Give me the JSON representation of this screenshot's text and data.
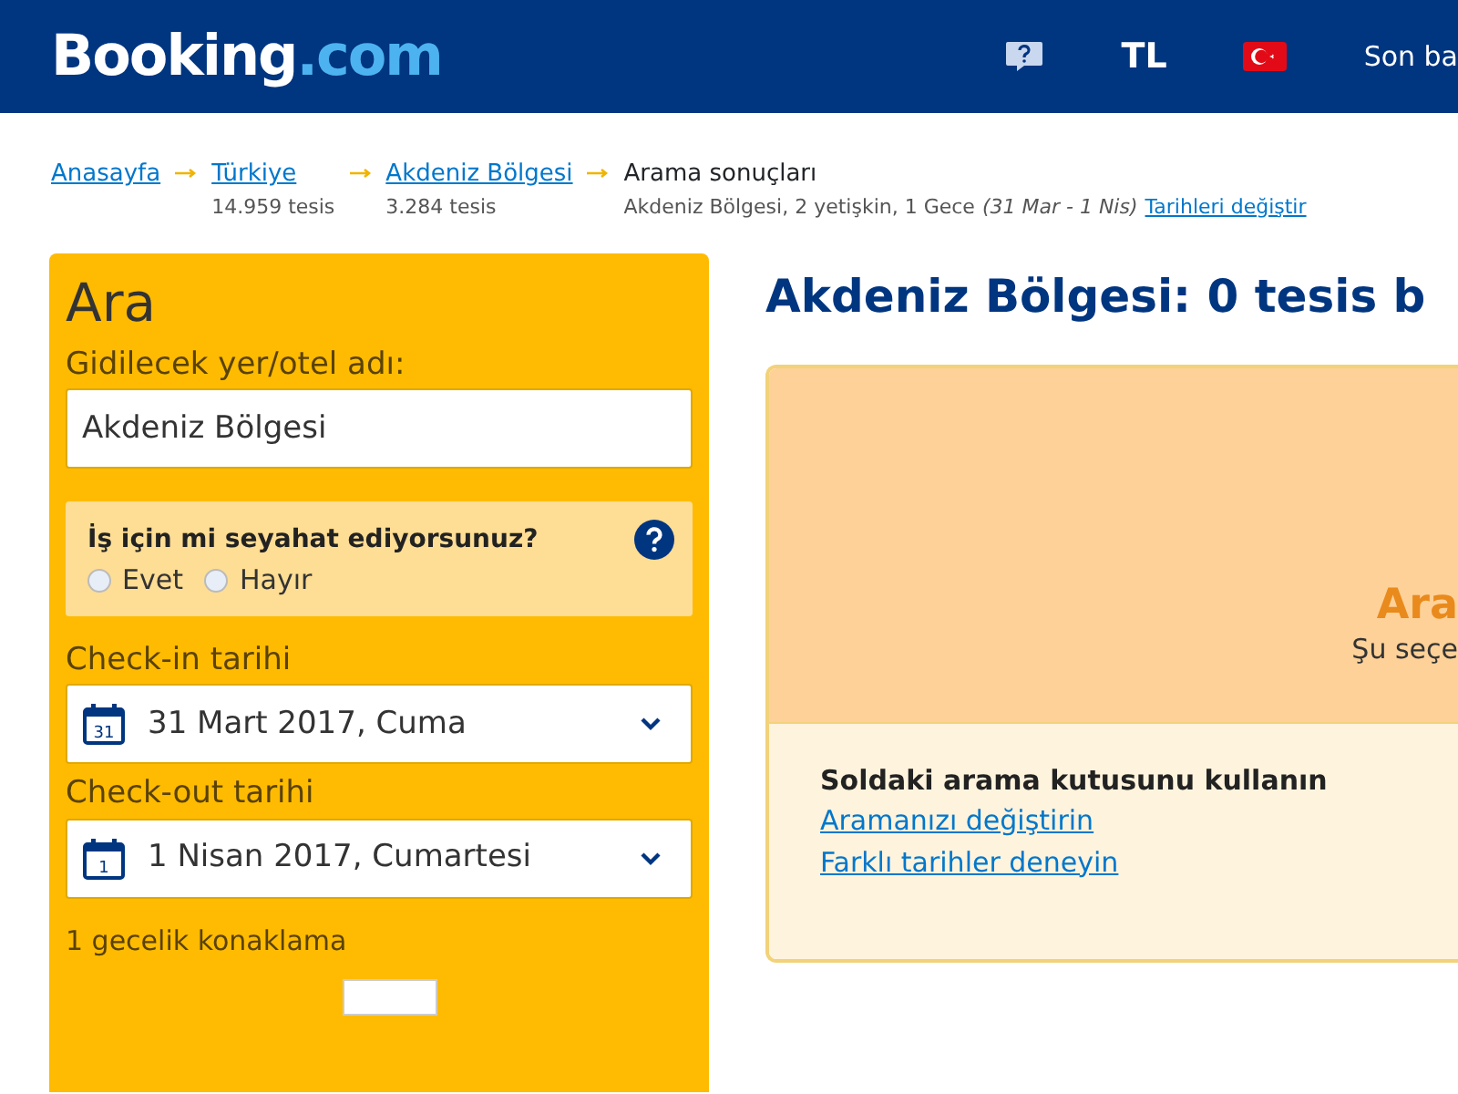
{
  "header": {
    "logo_main": "Booking",
    "logo_suffix": ".com",
    "currency": "TL",
    "recent": "Son ba"
  },
  "breadcrumb": [
    {
      "label": "Anasayfa"
    },
    {
      "label": "Türkiye",
      "sub": "14.959 tesis"
    },
    {
      "label": "Akdeniz Bölgesi",
      "sub": "3.284 tesis"
    }
  ],
  "current": {
    "label": "Arama sonuçları",
    "summary": "Akdeniz Bölgesi, 2 yetişkin, 1 Gece",
    "dates": "(31 Mar - 1 Nis)",
    "change_link": "Tarihleri değiştir"
  },
  "search": {
    "title": "Ara",
    "destination_label": "Gidilecek yer/otel adı:",
    "destination_value": "Akdeniz Bölgesi",
    "business_question": "İş için mi seyahat ediyorsunuz?",
    "business_options": [
      {
        "label": "Evet",
        "selected": false
      },
      {
        "label": "Hayır",
        "selected": false
      }
    ],
    "checkin_label": "Check-in tarihi",
    "checkin_day": "31",
    "checkin_value": "31 Mart 2017, Cuma",
    "checkout_label": "Check-out tarihi",
    "checkout_day": "1",
    "checkout_value": "1 Nisan 2017, Cumartesi",
    "stay_note": "1 gecelik konaklama"
  },
  "results": {
    "heading": "Akdeniz Bölgesi: 0 tesis b",
    "notice_title": "Ara",
    "notice_text": "Şu seçe",
    "tips_title": "Soldaki arama kutusunu kullanın",
    "tips_links": [
      "Aramanızı değiştirin",
      "Farklı tarihler deneyin"
    ]
  }
}
